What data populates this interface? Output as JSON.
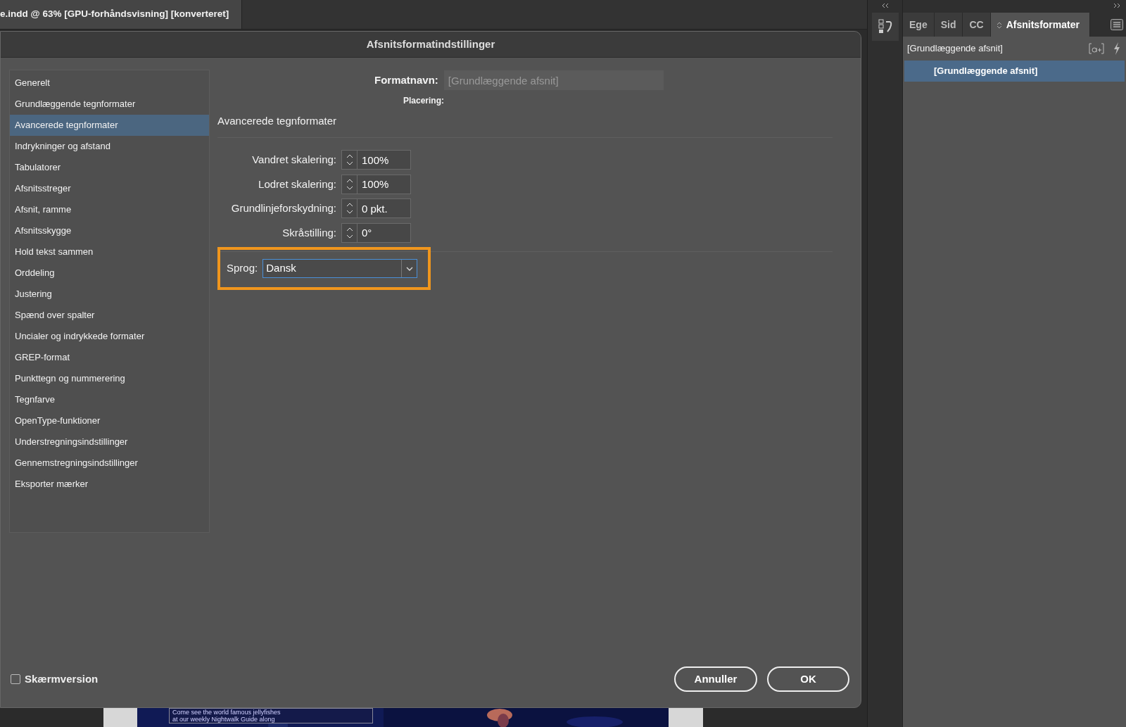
{
  "document_tab": {
    "title": "e.indd @ 63% [GPU-forhåndsvisning] [konverteret]"
  },
  "dialog": {
    "title": "Afsnitsformatindstillinger",
    "categories": [
      {
        "label": "Generelt",
        "selected": false
      },
      {
        "label": "Grundlæggende tegnformater",
        "selected": false
      },
      {
        "label": "Avancerede tegnformater",
        "selected": true
      },
      {
        "label": "Indrykninger og afstand",
        "selected": false
      },
      {
        "label": "Tabulatorer",
        "selected": false
      },
      {
        "label": "Afsnitsstreger",
        "selected": false
      },
      {
        "label": "Afsnit, ramme",
        "selected": false
      },
      {
        "label": "Afsnitsskygge",
        "selected": false
      },
      {
        "label": "Hold tekst sammen",
        "selected": false
      },
      {
        "label": "Orddeling",
        "selected": false
      },
      {
        "label": "Justering",
        "selected": false
      },
      {
        "label": "Spænd over spalter",
        "selected": false
      },
      {
        "label": "Uncialer og indrykkede formater",
        "selected": false
      },
      {
        "label": "GREP-format",
        "selected": false
      },
      {
        "label": "Punkttegn og nummerering",
        "selected": false
      },
      {
        "label": "Tegnfarve",
        "selected": false
      },
      {
        "label": "OpenType-funktioner",
        "selected": false
      },
      {
        "label": "Understregningsindstillinger",
        "selected": false
      },
      {
        "label": "Gennemstregningsindstillinger",
        "selected": false
      },
      {
        "label": "Eksporter mærker",
        "selected": false
      }
    ],
    "format_name": {
      "label": "Formatnavn:",
      "value": "[Grundlæggende afsnit]",
      "disabled": true
    },
    "placement": {
      "label": "Placering:"
    },
    "section_title": "Avancerede tegnformater",
    "fields": [
      {
        "label": "Vandret skalering:",
        "value": "100%"
      },
      {
        "label": "Lodret skalering:",
        "value": "100%"
      },
      {
        "label": "Grundlinjeforskydning:",
        "value": "0 pkt."
      },
      {
        "label": "Skråstilling:",
        "value": "0°"
      }
    ],
    "language": {
      "label": "Sprog:",
      "value": "Dansk",
      "highlighted": true
    },
    "preview": {
      "label": "Skærmversion",
      "checked": false
    },
    "buttons": [
      {
        "label": "Annuller",
        "kind": "cancel"
      },
      {
        "label": "OK",
        "kind": "ok"
      }
    ]
  },
  "panel": {
    "tabs": [
      {
        "label": "Ege",
        "selected": false
      },
      {
        "label": "Sid",
        "selected": false
      },
      {
        "label": "CC",
        "selected": false
      },
      {
        "label": "Afsnitsformater",
        "selected": true
      }
    ],
    "current_style": "[Grundlæggende afsnit]",
    "styles": [
      {
        "label": "[Grundlæggende afsnit]",
        "selected": true
      }
    ]
  },
  "document": {
    "text_lines": [
      "Come see the world famous jellyfishes",
      "at our weekly Nightwalk Guide along"
    ]
  }
}
